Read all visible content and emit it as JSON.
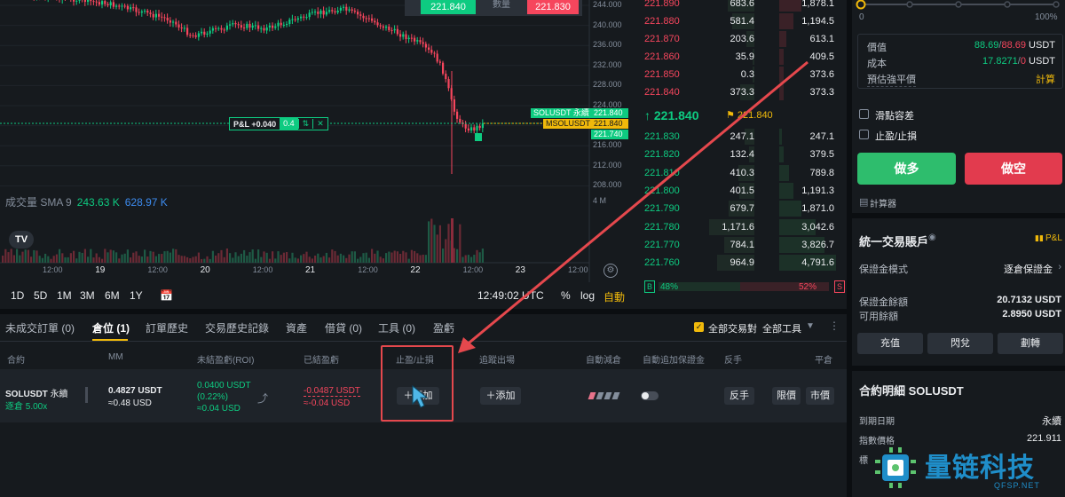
{
  "chart": {
    "price_ticks": [
      "244.000",
      "240.000",
      "236.000",
      "232.000",
      "228.000",
      "224.000",
      "220.000",
      "216.000",
      "212.000",
      "208.000"
    ],
    "time_ticks": [
      {
        "label": "12:00",
        "day": false
      },
      {
        "label": "19",
        "day": true
      },
      {
        "label": "12:00",
        "day": false
      },
      {
        "label": "20",
        "day": true
      },
      {
        "label": "12:00",
        "day": false
      },
      {
        "label": "21",
        "day": true
      },
      {
        "label": "12:00",
        "day": false
      },
      {
        "label": "22",
        "day": true
      },
      {
        "label": "12:00",
        "day": false
      },
      {
        "label": "23",
        "day": true
      },
      {
        "label": "12:00",
        "day": false
      }
    ],
    "volume_label": "成交量 SMA 9",
    "volume_v1": "243.63 K",
    "volume_v2": "628.97 K",
    "volume_axis_label": "4 M",
    "tv_logo": "TV",
    "pl_text": "P&L +0.040",
    "pl_qty": "0.4",
    "pl_close": "✕",
    "tag_symbol": "SOLUSDT 永續",
    "tag_symbol_price": "221.840",
    "tag_mark": "MSOLUSDT",
    "tag_mark_price": "221.840",
    "tag_last": "221.740",
    "top_buy": "221.840",
    "top_mid": "數量",
    "top_sell": "221.830",
    "timeframes": [
      "1D",
      "5D",
      "1M",
      "3M",
      "6M",
      "1Y"
    ],
    "clock": "12:49:02 UTC",
    "pct": "%",
    "log": "log",
    "auto": "自動"
  },
  "orderbook": {
    "asks": [
      {
        "price": "221.890",
        "size": "683.6",
        "total": "1,878.1"
      },
      {
        "price": "221.880",
        "size": "581.4",
        "total": "1,194.5"
      },
      {
        "price": "221.870",
        "size": "203.6",
        "total": "613.1"
      },
      {
        "price": "221.860",
        "size": "35.9",
        "total": "409.5"
      },
      {
        "price": "221.850",
        "size": "0.3",
        "total": "373.6"
      },
      {
        "price": "221.840",
        "size": "373.3",
        "total": "373.3"
      }
    ],
    "mid_price": "↑ 221.840",
    "mid_mark": "⚑ 221.840",
    "bids": [
      {
        "price": "221.830",
        "size": "247.1",
        "total": "247.1"
      },
      {
        "price": "221.820",
        "size": "132.4",
        "total": "379.5"
      },
      {
        "price": "221.810",
        "size": "410.3",
        "total": "789.8"
      },
      {
        "price": "221.800",
        "size": "401.5",
        "total": "1,191.3"
      },
      {
        "price": "221.790",
        "size": "679.7",
        "total": "1,871.0"
      },
      {
        "price": "221.780",
        "size": "1,171.6",
        "total": "3,042.6"
      },
      {
        "price": "221.770",
        "size": "784.1",
        "total": "3,826.7"
      },
      {
        "price": "221.760",
        "size": "964.9",
        "total": "4,791.6"
      }
    ],
    "buy_badge": "B",
    "buy_pct": "48%",
    "buy_ratio": 0.48,
    "sell_pct": "52%",
    "sell_badge": "S"
  },
  "right": {
    "slider_min": "0",
    "slider_max": "100%",
    "value_label": "價值",
    "value_long": "88.69",
    "value_short": "88.69",
    "value_unit": "USDT",
    "cost_label": "成本",
    "cost_long": "17.8271",
    "cost_short": "0",
    "cost_unit": "USDT",
    "liq_label": "預估強平價",
    "liq_value": "計算",
    "slippage_label": "滑點容差",
    "tpsl_label": "止盈/止損",
    "long_btn": "做多",
    "short_btn": "做空",
    "calculator": "計算器",
    "account_title": "統一交易賬戶",
    "pl_link": "P&L",
    "margin_mode_label": "保證金模式",
    "margin_mode_value": "逐倉保證金",
    "margin_balance_label": "保證金餘額",
    "margin_balance_value": "20.7132 USDT",
    "available_label": "可用餘額",
    "available_value": "2.8950 USDT",
    "deposit_btn": "充值",
    "convert_btn": "閃兌",
    "transfer_btn": "劃轉",
    "contract_title": "合約明細 SOLUSDT",
    "expiry_label": "到期日期",
    "expiry_value": "永續",
    "index_label": "指數價格",
    "index_value": "221.911",
    "mark_label_cut": "標"
  },
  "bottom": {
    "tabs": [
      "未成交訂單 (0)",
      "倉位 (1)",
      "訂單歷史",
      "交易歷史記錄",
      "資產",
      "借貸 (0)",
      "工具 (0)",
      "盈虧"
    ],
    "all_pairs_label": "全部交易對",
    "all_tools_label": "全部工具",
    "columns": [
      "合約",
      "MM",
      "未結盈虧(ROI)",
      "已結盈虧",
      "止盈/止損",
      "追蹤出場",
      "自動減倉",
      "自動追加保證金",
      "反手",
      "平倉"
    ],
    "position": {
      "symbol": "SOLUSDT",
      "perp": "永續",
      "leverage": "逐倉 5.00x",
      "mm_1": "0.4827 USDT",
      "mm_2": "≈0.48 USD",
      "upnl_1": "0.0400 USDT",
      "upnl_2": "(0.22%)",
      "upnl_3": "≈0.04 USD",
      "rpnl_1": "-0.0487 USDT",
      "rpnl_2": "≈-0.04 USD",
      "tpsl_add": "＋添加",
      "trail_add": "＋添加",
      "reverse_btn": "反手",
      "limit_btn": "限價",
      "market_btn": "市價"
    }
  },
  "watermark": {
    "text": "量链科技",
    "sub": "QFSP.NET"
  },
  "colors": {
    "up": "#0ecb81",
    "down": "#f6465d",
    "accent": "#f0b90b",
    "annotation": "#e5484d"
  }
}
